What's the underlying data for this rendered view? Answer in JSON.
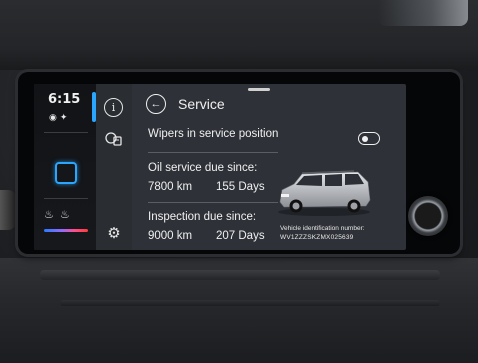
{
  "status_bar": {
    "time": "6:15"
  },
  "left_panel": {
    "status_icons": [
      "satellite-icon",
      "person-icon"
    ],
    "home_icon": "square-home-icon",
    "seat_icons": [
      "seat-heat-left-icon",
      "seat-heat-right-icon"
    ],
    "temp_colors": [
      "#2b7bff",
      "#ff3b3b"
    ]
  },
  "nav_icons": [
    {
      "name": "info-icon",
      "glyph": "i"
    },
    {
      "name": "oil-service-icon",
      "glyph": "🛢"
    },
    {
      "name": "settings-icon",
      "glyph": "⚙"
    }
  ],
  "header": {
    "back_glyph": "←",
    "title": "Service"
  },
  "wipers": {
    "label": "Wipers in service position",
    "toggle_on": false
  },
  "oil_service": {
    "label": "Oil service due since:",
    "distance": "7800 km",
    "days": "155 Days"
  },
  "inspection": {
    "label": "Inspection due since:",
    "distance": "9000 km",
    "days": "207 Days"
  },
  "vehicle": {
    "vin_label": "Vehicle identification number:",
    "vin": "WV1ZZZSKZMX025639",
    "car_color": "#c9ccd0"
  },
  "accent_color": "#2aa6ff"
}
